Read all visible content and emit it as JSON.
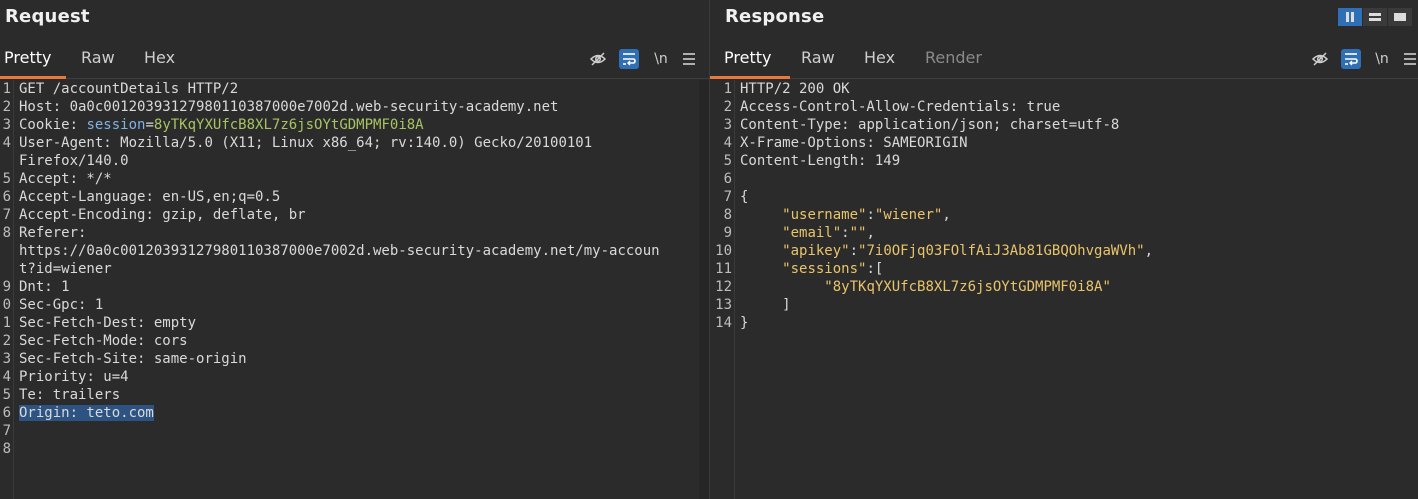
{
  "request": {
    "title": "Request",
    "tabs": [
      "Pretty",
      "Raw",
      "Hex"
    ],
    "active_tab": "Pretty",
    "tools": {
      "hide_icon": "eye-slash-icon",
      "wrap_icon": "wrap-icon",
      "newline_label": "\\n",
      "menu_icon": "hamburger-icon"
    },
    "lines": [
      {
        "n": "1",
        "parts": [
          {
            "t": "GET /accountDetails HTTP/2",
            "c": "val"
          }
        ]
      },
      {
        "n": "2",
        "parts": [
          {
            "t": "Host",
            "c": "key"
          },
          {
            "t": ": 0a0c00120393127980110387000e7002d.web-security-academy.net",
            "c": "val"
          }
        ]
      },
      {
        "n": "3",
        "parts": [
          {
            "t": "Cookie",
            "c": "key"
          },
          {
            "t": ": ",
            "c": "val"
          },
          {
            "t": "session",
            "c": "blue"
          },
          {
            "t": "=",
            "c": "val"
          },
          {
            "t": "8yTKqYXUfcB8XL7z6jsOYtGDMPMF0i8A",
            "c": "green"
          }
        ]
      },
      {
        "n": "4",
        "parts": [
          {
            "t": "User-Agent",
            "c": "key"
          },
          {
            "t": ": Mozilla/5.0 (X11; Linux x86_64; rv:140.0) Gecko/20100101",
            "c": "val"
          }
        ]
      },
      {
        "n": "",
        "parts": [
          {
            "t": "Firefox/140.0",
            "c": "val"
          }
        ]
      },
      {
        "n": "5",
        "parts": [
          {
            "t": "Accept",
            "c": "key"
          },
          {
            "t": ": */*",
            "c": "val"
          }
        ]
      },
      {
        "n": "6",
        "parts": [
          {
            "t": "Accept-Language",
            "c": "key"
          },
          {
            "t": ": en-US,en;q=0.5",
            "c": "val"
          }
        ]
      },
      {
        "n": "7",
        "parts": [
          {
            "t": "Accept-Encoding",
            "c": "key"
          },
          {
            "t": ": gzip, deflate, br",
            "c": "val"
          }
        ]
      },
      {
        "n": "8",
        "parts": [
          {
            "t": "Referer",
            "c": "key"
          },
          {
            "t": ":",
            "c": "val"
          }
        ]
      },
      {
        "n": "",
        "parts": [
          {
            "t": "https://0a0c00120393127980110387000e7002d.web-security-academy.net/my-accoun",
            "c": "val"
          }
        ]
      },
      {
        "n": "",
        "parts": [
          {
            "t": "t?id=wiener",
            "c": "val"
          }
        ]
      },
      {
        "n": "9",
        "parts": [
          {
            "t": "Dnt",
            "c": "key"
          },
          {
            "t": ": 1",
            "c": "val"
          }
        ]
      },
      {
        "n": "0",
        "parts": [
          {
            "t": "Sec-Gpc",
            "c": "key"
          },
          {
            "t": ": 1",
            "c": "val"
          }
        ]
      },
      {
        "n": "1",
        "parts": [
          {
            "t": "Sec-Fetch-Dest",
            "c": "key"
          },
          {
            "t": ": empty",
            "c": "val"
          }
        ]
      },
      {
        "n": "2",
        "parts": [
          {
            "t": "Sec-Fetch-Mode",
            "c": "key"
          },
          {
            "t": ": cors",
            "c": "val"
          }
        ]
      },
      {
        "n": "3",
        "parts": [
          {
            "t": "Sec-Fetch-Site",
            "c": "key"
          },
          {
            "t": ": same-origin",
            "c": "val"
          }
        ]
      },
      {
        "n": "4",
        "parts": [
          {
            "t": "Priority",
            "c": "key"
          },
          {
            "t": ": u=4",
            "c": "val"
          }
        ]
      },
      {
        "n": "5",
        "parts": [
          {
            "t": "Te",
            "c": "key"
          },
          {
            "t": ": trailers",
            "c": "val"
          }
        ]
      },
      {
        "n": "6",
        "parts": [
          {
            "t": "Origin: teto.com",
            "c": "val sel"
          }
        ]
      },
      {
        "n": "7",
        "parts": []
      },
      {
        "n": "8",
        "parts": []
      }
    ]
  },
  "response": {
    "title": "Response",
    "tabs": [
      "Pretty",
      "Raw",
      "Hex",
      "Render"
    ],
    "active_tab": "Pretty",
    "tools": {
      "hide_icon": "eye-slash-icon",
      "wrap_icon": "wrap-icon",
      "newline_label": "\\n",
      "menu_icon": "hamburger-icon"
    },
    "layout_icons": [
      "split-vertical-icon",
      "split-horizontal-icon",
      "tabs-layout-icon"
    ],
    "lines": [
      {
        "n": "1",
        "parts": [
          {
            "t": "HTTP/2 200 OK",
            "c": "val"
          }
        ]
      },
      {
        "n": "2",
        "parts": [
          {
            "t": "Access-Control-Allow-Credentials",
            "c": "key"
          },
          {
            "t": ": true",
            "c": "val"
          }
        ]
      },
      {
        "n": "3",
        "parts": [
          {
            "t": "Content-Type",
            "c": "key"
          },
          {
            "t": ": application/json; charset=utf-8",
            "c": "val"
          }
        ]
      },
      {
        "n": "4",
        "parts": [
          {
            "t": "X-Frame-Options",
            "c": "key"
          },
          {
            "t": ": SAMEORIGIN",
            "c": "val"
          }
        ]
      },
      {
        "n": "5",
        "parts": [
          {
            "t": "Content-Length",
            "c": "key"
          },
          {
            "t": ": 149",
            "c": "val"
          }
        ]
      },
      {
        "n": "6",
        "parts": []
      },
      {
        "n": "7",
        "parts": [
          {
            "t": "{",
            "c": "val"
          }
        ]
      },
      {
        "n": "8",
        "parts": [
          {
            "t": "     ",
            "c": "val"
          },
          {
            "t": "\"username\"",
            "c": "orange"
          },
          {
            "t": ":",
            "c": "val"
          },
          {
            "t": "\"wiener\"",
            "c": "orange"
          },
          {
            "t": ",",
            "c": "val"
          }
        ]
      },
      {
        "n": "9",
        "parts": [
          {
            "t": "     ",
            "c": "val"
          },
          {
            "t": "\"email\"",
            "c": "orange"
          },
          {
            "t": ":",
            "c": "val"
          },
          {
            "t": "\"\"",
            "c": "orange"
          },
          {
            "t": ",",
            "c": "val"
          }
        ]
      },
      {
        "n": "10",
        "parts": [
          {
            "t": "     ",
            "c": "val"
          },
          {
            "t": "\"apikey\"",
            "c": "orange"
          },
          {
            "t": ":",
            "c": "val"
          },
          {
            "t": "\"7i0OFjq03FOlfAiJ3Ab81GBQOhvgaWVh\"",
            "c": "orange"
          },
          {
            "t": ",",
            "c": "val"
          }
        ]
      },
      {
        "n": "11",
        "parts": [
          {
            "t": "     ",
            "c": "val"
          },
          {
            "t": "\"sessions\"",
            "c": "orange"
          },
          {
            "t": ":[",
            "c": "val"
          }
        ]
      },
      {
        "n": "12",
        "parts": [
          {
            "t": "          ",
            "c": "val"
          },
          {
            "t": "\"8yTKqYXUfcB8XL7z6jsOYtGDMPMF0i8A\"",
            "c": "orange"
          }
        ]
      },
      {
        "n": "13",
        "parts": [
          {
            "t": "     ]",
            "c": "val"
          }
        ]
      },
      {
        "n": "14",
        "parts": [
          {
            "t": "}",
            "c": "val"
          }
        ]
      }
    ]
  }
}
